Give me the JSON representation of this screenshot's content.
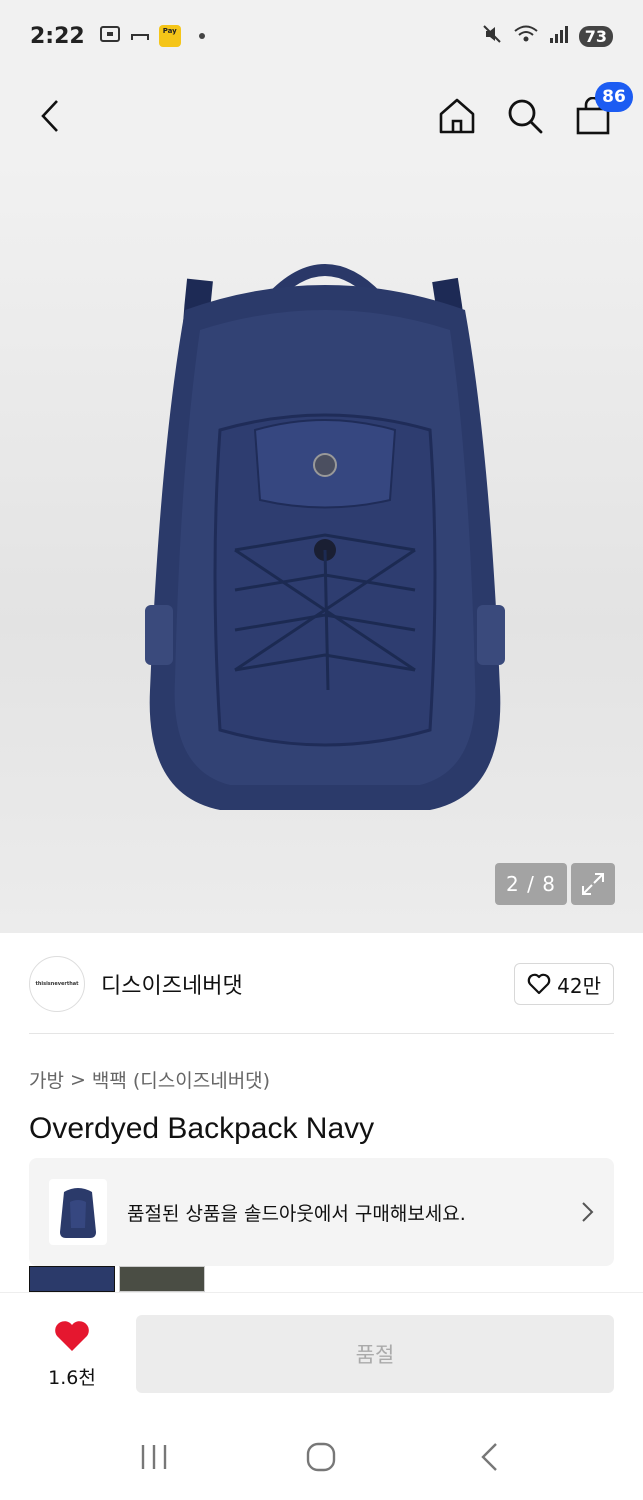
{
  "status_bar": {
    "time": "2:22",
    "battery": "73",
    "kpay_label": "Pay"
  },
  "header": {
    "cart_count": "86"
  },
  "gallery": {
    "counter": "2 / 8"
  },
  "brand": {
    "logo_text": "thisisneverthat",
    "name": "디스이즈네버댓",
    "likes": "42만"
  },
  "breadcrumb": {
    "category": "가방",
    "separator": ">",
    "subcategory": "백팩 (디스이즈네버댓)"
  },
  "product": {
    "title": "Overdyed Backpack Navy"
  },
  "soldout_banner": {
    "text": "품절된 상품을 솔드아웃에서 구매해보세요."
  },
  "bottom_bar": {
    "wish_count": "1.6천",
    "purchase_label": "품절"
  },
  "colors": {
    "accent": "#1c5cf2",
    "heart": "#e5172f",
    "backpack": "#2b3a6a"
  }
}
